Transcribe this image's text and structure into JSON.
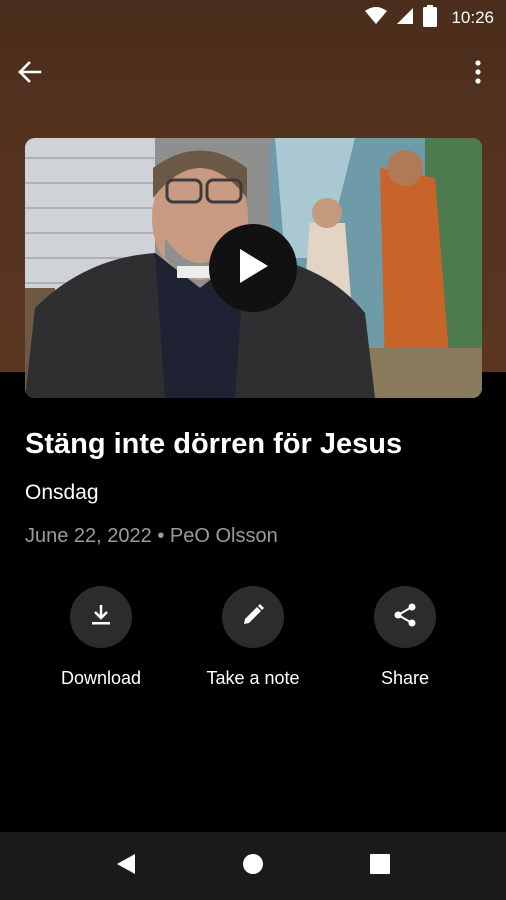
{
  "status_bar": {
    "time": "10:26"
  },
  "app_bar": {
    "back_icon": "arrow-left-icon",
    "menu_icon": "more-vertical-icon"
  },
  "video": {
    "play_icon": "play-icon"
  },
  "sermon": {
    "title": "Stäng inte dörren för Jesus",
    "subtitle": "Onsdag",
    "date": "June 22, 2022",
    "separator": "•",
    "speaker": "PeO Olsson"
  },
  "actions": [
    {
      "label": "Download",
      "icon": "download-icon"
    },
    {
      "label": "Take a note",
      "icon": "pencil-icon"
    },
    {
      "label": "Share",
      "icon": "share-icon"
    }
  ],
  "colors": {
    "hero_bg": "#55331f",
    "background": "#000000",
    "action_circle": "#2c2c2c",
    "meta_text": "#9b9b9b"
  }
}
